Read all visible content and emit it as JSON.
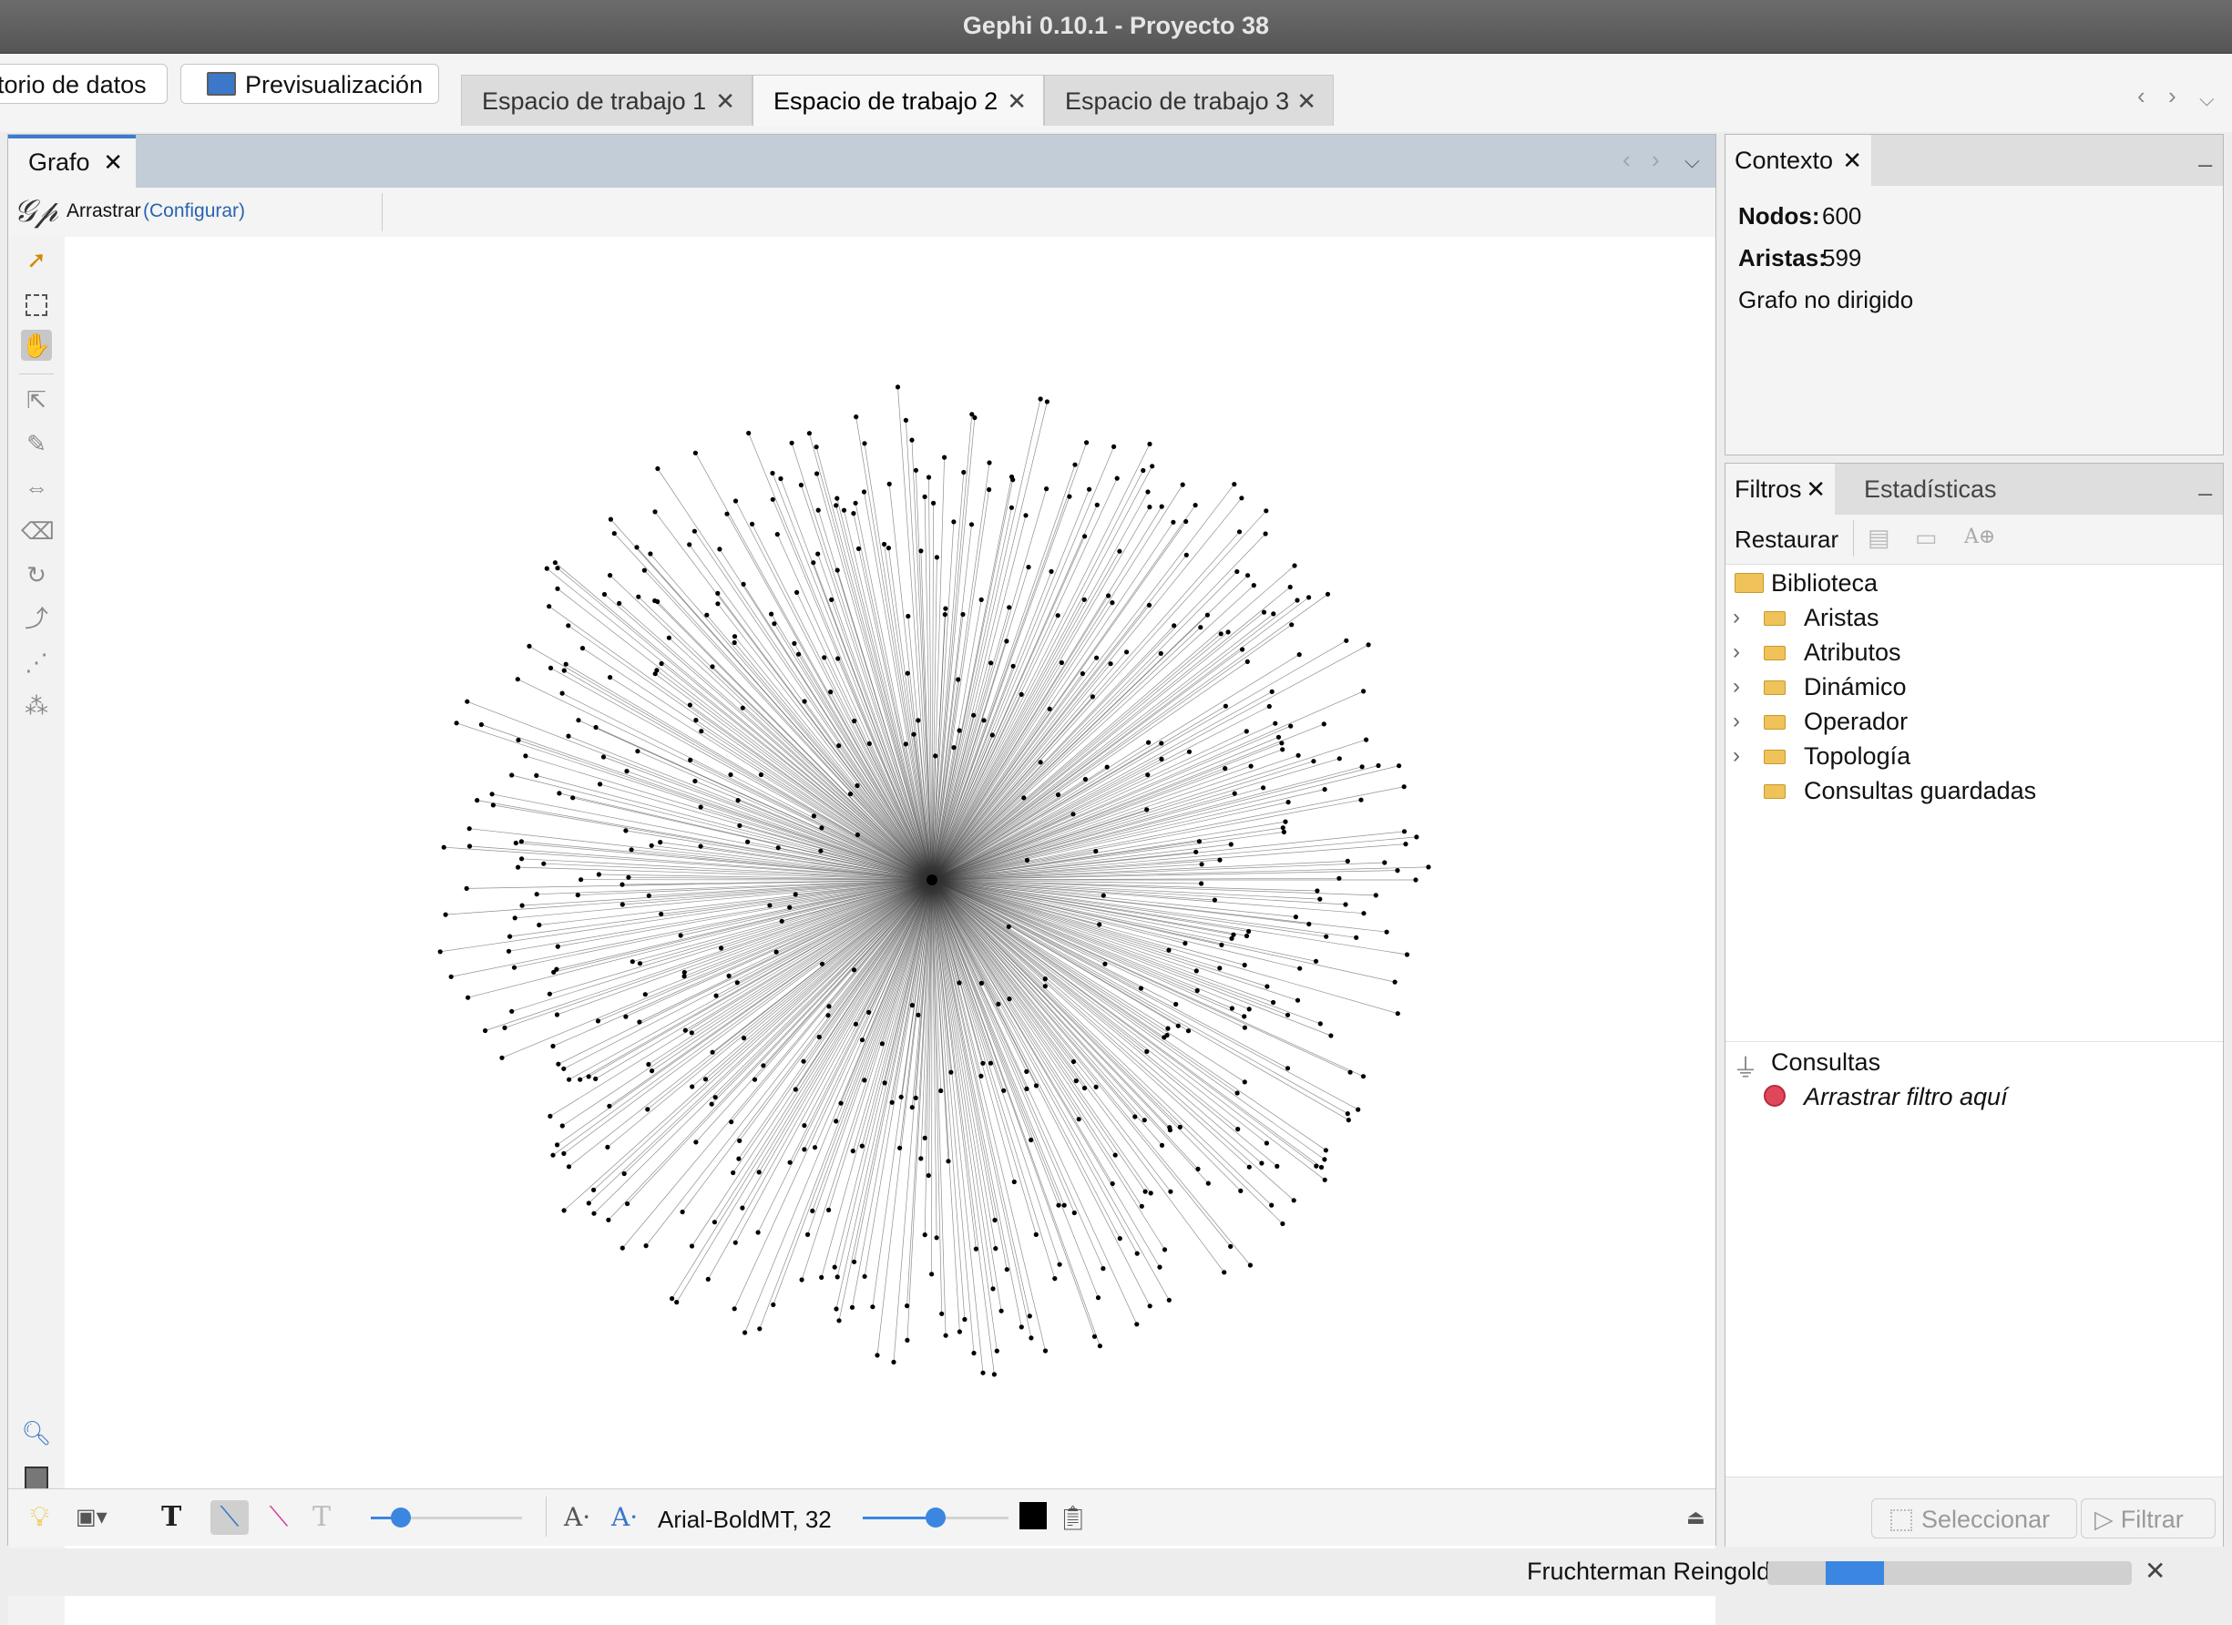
{
  "window": {
    "title": "Gephi 0.10.1 - Proyecto 38"
  },
  "toolbar": {
    "data_lab_label": "torio de datos",
    "preview_label": "Previsualización"
  },
  "workspaces": [
    {
      "label": "Espacio de trabajo 1",
      "active": false
    },
    {
      "label": "Espacio de trabajo 2",
      "active": true
    },
    {
      "label": "Espacio de trabajo 3",
      "active": false
    }
  ],
  "graph": {
    "tab_label": "Grafo",
    "tool_label": "Arrastrar",
    "configure_label": "(Configurar)",
    "font_label": "Arial-BoldMT, 32",
    "edge_scale_slider": 0.2,
    "label_size_slider": 0.5,
    "network": {
      "layout": "radial star",
      "center_node": 1,
      "leaf_nodes": 599,
      "node_color": "#000000",
      "edge_color": "#333333"
    }
  },
  "context": {
    "tab_label": "Contexto",
    "nodes_label": "Nodos:",
    "nodes_value": "600",
    "edges_label": "Aristas:",
    "edges_value": "599",
    "graph_type": "Grafo no dirigido"
  },
  "filters": {
    "tab_label": "Filtros",
    "stats_tab_label": "Estadísticas",
    "reset_label": "Restaurar",
    "library_label": "Biblioteca",
    "library_items": [
      "Aristas",
      "Atributos",
      "Dinámico",
      "Operador",
      "Topología",
      "Consultas guardadas"
    ],
    "queries_label": "Consultas",
    "drop_hint": "Arrastrar filtro aquí",
    "select_label": "Seleccionar",
    "filter_label": "Filtrar"
  },
  "status": {
    "layout_name": "Fruchterman Reingold",
    "progress": 0.16
  },
  "icons": {
    "close": "close-icon",
    "chevron_left": "chevron-left-icon",
    "chevron_right": "chevron-right-icon",
    "chevron_down": "chevron-down-icon",
    "folder": "folder-icon",
    "funnel": "funnel-icon"
  },
  "colors": {
    "accent": "#3a7bd5",
    "title_bar": "#5e5e5e",
    "graph_header": "#c2cdd8",
    "progress": "#3a86e0"
  }
}
